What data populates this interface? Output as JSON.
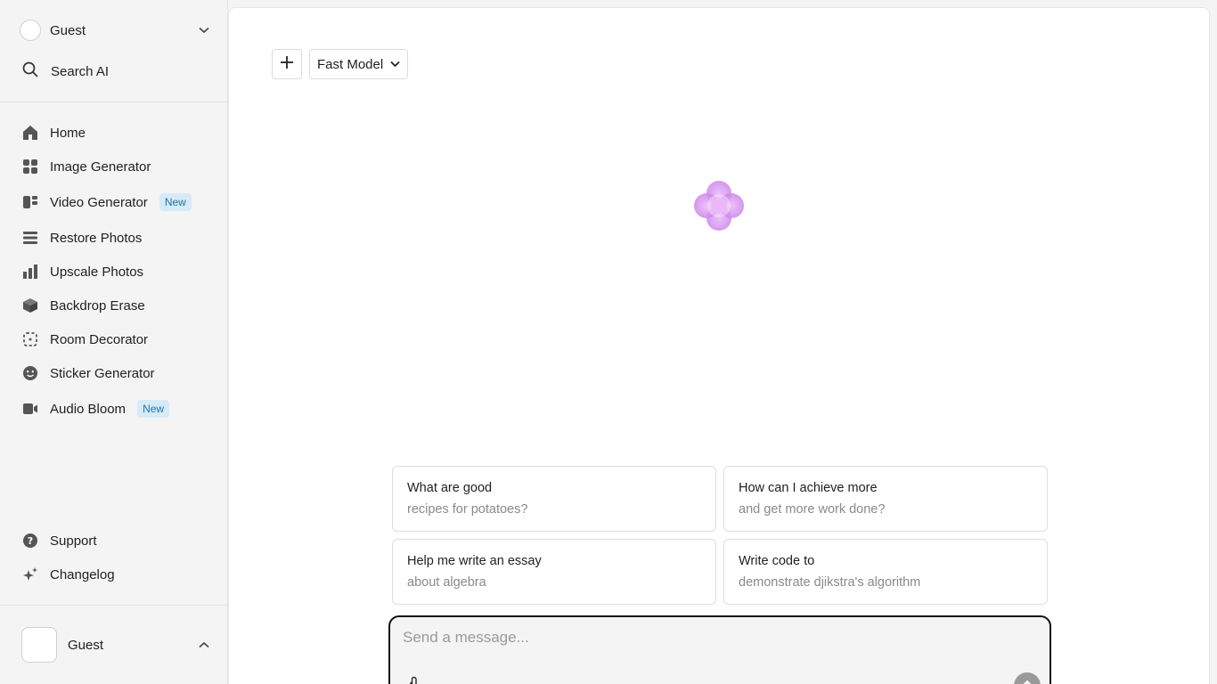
{
  "sidebar": {
    "user_top_name": "Guest",
    "search_label": "Search AI",
    "nav": [
      {
        "label": "Home",
        "icon": "home-icon"
      },
      {
        "label": "Image Generator",
        "icon": "grid-icon"
      },
      {
        "label": "Video Generator",
        "icon": "video-layout-icon",
        "badge": "New"
      },
      {
        "label": "Restore Photos",
        "icon": "stack-icon"
      },
      {
        "label": "Upscale Photos",
        "icon": "bar-chart-icon"
      },
      {
        "label": "Backdrop Erase",
        "icon": "cube-icon"
      },
      {
        "label": "Room Decorator",
        "icon": "dotted-square-icon"
      },
      {
        "label": "Sticker Generator",
        "icon": "smiley-icon"
      },
      {
        "label": "Audio Bloom",
        "icon": "camera-icon",
        "badge": "New"
      }
    ],
    "support_label": "Support",
    "changelog_label": "Changelog",
    "user_bottom_name": "Guest"
  },
  "header": {
    "model_label": "Fast Model"
  },
  "suggestions": [
    {
      "line1": "What are good",
      "line2": "recipes for potatoes?"
    },
    {
      "line1": "How can I achieve more",
      "line2": "and get more work done?"
    },
    {
      "line1": "Help me write an essay",
      "line2": "about algebra"
    },
    {
      "line1": "Write code to",
      "line2": "demonstrate djikstra's algorithm"
    }
  ],
  "composer": {
    "placeholder": "Send a message...",
    "value": ""
  },
  "colors": {
    "accent_logo": "#d98cf0",
    "badge_bg": "#d6ebf7",
    "badge_text": "#2270a8",
    "composer_border": "#111111"
  }
}
